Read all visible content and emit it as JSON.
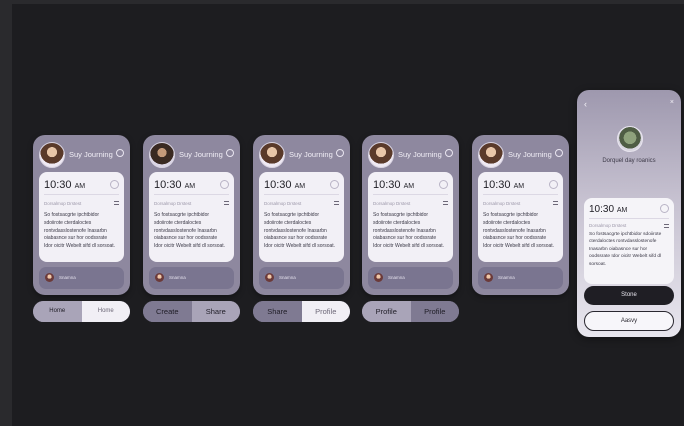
{
  "cards": [
    {
      "name": "Suy Journing",
      "time": "10:30",
      "ampm": "AM",
      "subhead": "Dorsalmop Drstest",
      "body": "So fostsacgrte ipchtbidor sdoiirote cterdaloctes rontvdasslostenofe Inasarbn oiabasnce sur hor oodssrate Idor oicitr Webelt sifd dl sorsoat.",
      "footer": "Snamna"
    },
    {
      "name": "Suy Journing",
      "time": "10:30",
      "ampm": "AM",
      "subhead": "Dorsalmop Drstest",
      "body": "So fostsacgrte ipchtbidor sdoiirote cterdaloctes rontvdasslostenofe Inasarbn oiabasnce sur hor oodssrate Idor oicitr Webelt sifd dl sorsoat.",
      "footer": "Snamna"
    },
    {
      "name": "Suy Journing",
      "time": "10:30",
      "ampm": "AM",
      "subhead": "Dorsalmop Drstest",
      "body": "So fostsacgrte ipchtbidor sdoiirote cterdaloctes rontvdasslostenofe Inasarbn oiabasnce sur hor oodssrate Idor oicitr Webelt sifd dl sorsoat.",
      "footer": "Snamna"
    },
    {
      "name": "Suy Journing",
      "time": "10:30",
      "ampm": "AM",
      "subhead": "Dorsalmop Drstest",
      "body": "So fostsacgrte ipchtbidor sdoiirote cterdaloctes rontvdasslostenofe Inasarbn oiabasnce sur hor oodssrate Idor oicitr Webelt sifd dl sorsoat.",
      "footer": "Snamna"
    },
    {
      "name": "Suy Journing",
      "time": "10:30",
      "ampm": "AM",
      "subhead": "Dorsalmop Drstest",
      "body": "So fostsacgrte ipchtbidor sdoiirote cterdaloctes rontvdasslostenofe Inasarbn oiabasnce sur hor oodssrate Idor oicitr Webelt sifd dl sorsoat.",
      "footer": "Snamna"
    }
  ],
  "pills": [
    {
      "left": "Home",
      "right": "Home"
    },
    {
      "left": "Create",
      "right": "Share"
    },
    {
      "left": "Share",
      "right": "Profile"
    },
    {
      "left": "Profile",
      "right": "Profile"
    }
  ],
  "detail": {
    "back_icon": "‹",
    "close_icon": "×",
    "title": "Dorquel day roanics",
    "time": "10:30",
    "ampm": "AM",
    "subhead": "Dorsalmop Drstest",
    "body": "So fostsacgrte ipchtbidor sdoiirote cterdaloctes rontvdasslostenofe Inasarbn oiabasnce sur hor oodssrate Idor oicitr Webelt sifd dl sorsoat.",
    "primary_button": "Stone",
    "secondary_button": "Aasvy"
  },
  "colors": {
    "card": "#8e889f",
    "panel": "#f2f0f6",
    "background": "#1d1d20"
  },
  "icons": {
    "avatar": "avatar",
    "more": "circle-icon",
    "menu": "menu-icon"
  }
}
